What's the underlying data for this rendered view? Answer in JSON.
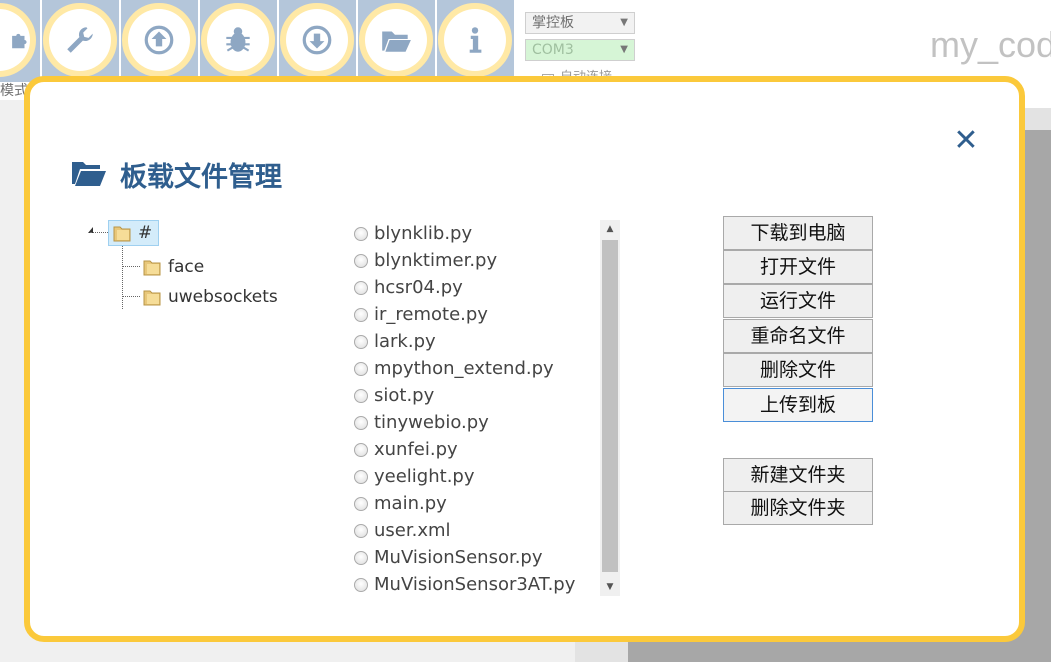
{
  "toolbar": {
    "partial_label": "模式",
    "buttons": [
      {
        "icon": "puzzle-icon"
      },
      {
        "icon": "wrench-icon"
      },
      {
        "icon": "upload-icon"
      },
      {
        "icon": "bug-icon"
      },
      {
        "icon": "download-icon"
      },
      {
        "icon": "folder-open-icon"
      },
      {
        "icon": "info-icon"
      }
    ],
    "board_select": "掌控板",
    "port_select": "COM3",
    "auto_connect": "自动连接",
    "project_name": "my_code"
  },
  "modal": {
    "title": "板载文件管理",
    "close_symbol": "✕",
    "tree": {
      "root": "#",
      "children": [
        "face",
        "uwebsockets"
      ]
    },
    "files": [
      "blynklib.py",
      "blynktimer.py",
      "hcsr04.py",
      "ir_remote.py",
      "lark.py",
      "mpython_extend.py",
      "siot.py",
      "tinywebio.py",
      "xunfei.py",
      "yeelight.py",
      "main.py",
      "user.xml",
      "MuVisionSensor.py",
      "MuVisionSensor3AT.py"
    ],
    "actions": {
      "download_to_pc": "下载到电脑",
      "open_file": "打开文件",
      "run_file": "运行文件",
      "rename_file": "重命名文件",
      "delete_file": "删除文件",
      "upload_to_board": "上传到板",
      "new_folder": "新建文件夹",
      "delete_folder": "删除文件夹"
    }
  },
  "colors": {
    "modal_border": "#fbc93b",
    "title_blue": "#2f5e8e",
    "toolbar_bg": "#b4c6da",
    "toolbar_ring": "#ffe9a6"
  }
}
